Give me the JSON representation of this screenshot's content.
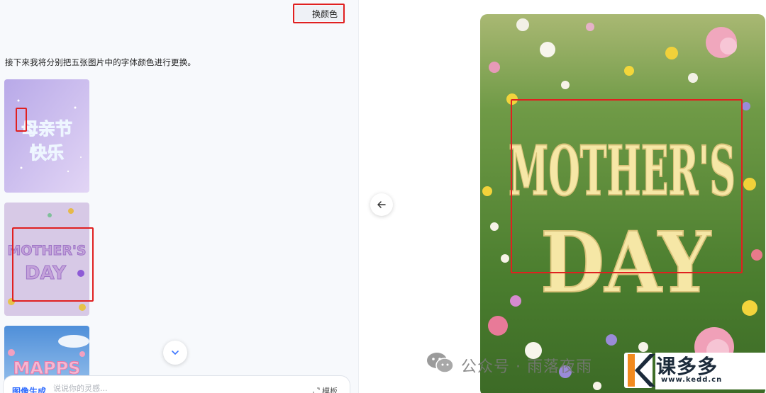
{
  "chat": {
    "user_message": "换颜色",
    "ai_message": "接下来我将分别把五张图片中的字体颜色进行更换。",
    "thumbnails": [
      {
        "text_line1": "母亲节",
        "text_line2": "快乐"
      },
      {
        "text_line1": "MOTHER'S",
        "text_line2": "DAY"
      },
      {
        "text_line1": "MAPPS"
      }
    ]
  },
  "composer": {
    "mode": "图像生成",
    "placeholder": "说说你的灵感...",
    "template_label": "模板"
  },
  "preview": {
    "line1": "MOTHER'S",
    "line2": "DAY"
  },
  "watermark": {
    "text": "公众号 · 雨落夜雨",
    "brand": "课多多",
    "url": "www.kedd.cn"
  },
  "colors": {
    "accent": "#2e6bff",
    "highlight": "#e02020"
  }
}
